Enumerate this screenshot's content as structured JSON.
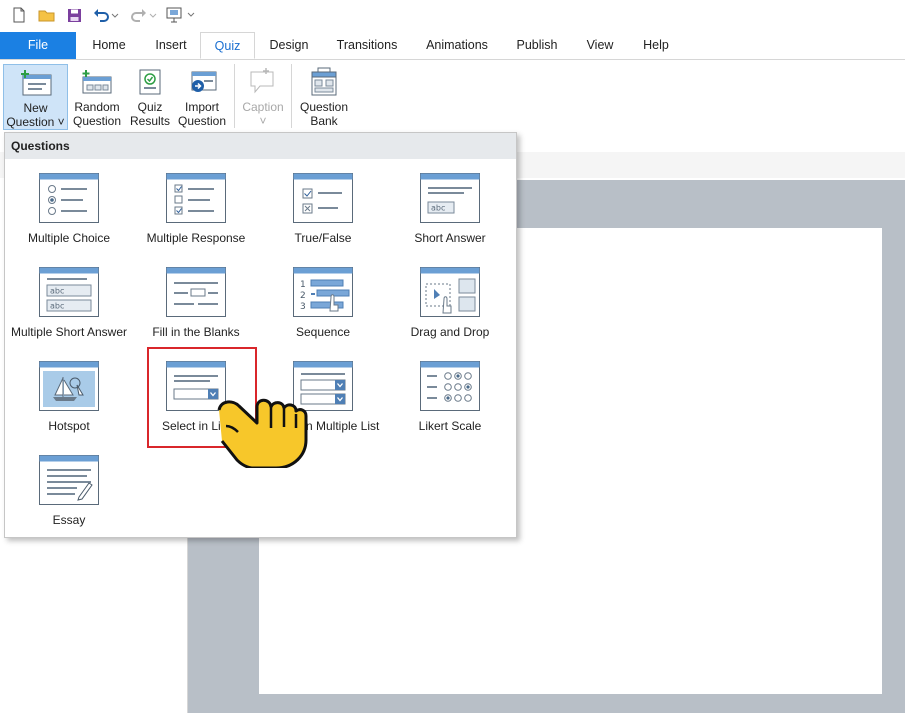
{
  "menu": {
    "tabs": [
      "File",
      "Home",
      "Insert",
      "Quiz",
      "Design",
      "Transitions",
      "Animations",
      "Publish",
      "View",
      "Help"
    ],
    "active": "Quiz"
  },
  "ribbon": {
    "new_question": [
      "New",
      "Question ˅"
    ],
    "random_question": [
      "Random",
      "Question"
    ],
    "quiz_results": [
      "Quiz",
      "Results"
    ],
    "import_question": [
      "Import",
      "Question"
    ],
    "caption": [
      "Caption",
      "˅"
    ],
    "question_bank": [
      "Question",
      "Bank"
    ]
  },
  "dropdown": {
    "header": "Questions",
    "items": [
      "Multiple Choice",
      "Multiple Response",
      "True/False",
      "Short Answer",
      "Multiple Short Answer",
      "Fill in the Blanks",
      "Sequence",
      "Drag and Drop",
      "Hotspot",
      "Select in List",
      "Select in Multiple List",
      "Likert Scale",
      "Essay"
    ]
  },
  "colors": {
    "accent": "#1b80e3",
    "thumb_header": "#6b9fd4",
    "highlight": "#d9262b",
    "hand": "#f7c72a"
  }
}
